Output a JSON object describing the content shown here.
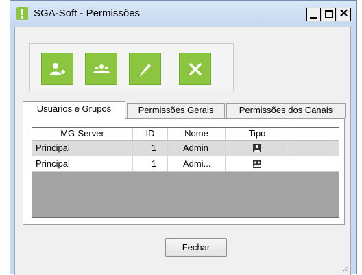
{
  "window": {
    "title": "SGA-Soft - Permissões",
    "minimize_label": "_",
    "close_label": "✕"
  },
  "toolbar": {
    "buttons": [
      {
        "icon": "add-user-icon"
      },
      {
        "icon": "group-icon"
      },
      {
        "icon": "pencil-icon"
      },
      {
        "icon": "delete-x-icon"
      }
    ]
  },
  "tabs": [
    {
      "label": "Usuários e Grupos",
      "active": true
    },
    {
      "label": "Permissões Gerais",
      "active": false
    },
    {
      "label": "Permissões dos Canais",
      "active": false
    }
  ],
  "grid": {
    "columns": [
      "MG-Server",
      "ID",
      "Nome",
      "Tipo"
    ],
    "rows": [
      {
        "server": "Principal",
        "id": "1",
        "name": "Admin",
        "type_icon": "user-icon",
        "selected": true
      },
      {
        "server": "Principal",
        "id": "1",
        "name": "Admi...",
        "type_icon": "group-icon",
        "selected": false
      }
    ]
  },
  "footer": {
    "close_button": "Fechar"
  },
  "colors": {
    "accent_green": "#8cc641",
    "titlebar": "#c9dbf0"
  }
}
